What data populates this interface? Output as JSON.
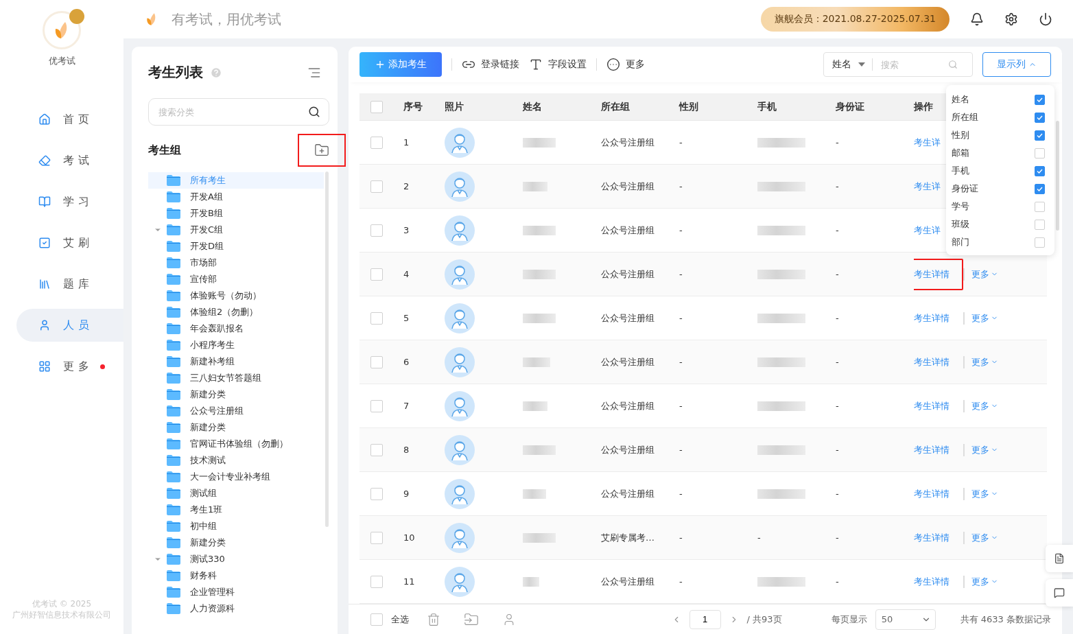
{
  "sidebar": {
    "brand": "优考试",
    "nav": [
      {
        "label": "首页",
        "selected": false
      },
      {
        "label": "考试",
        "selected": false
      },
      {
        "label": "学习",
        "selected": false
      },
      {
        "label": "艾刷",
        "selected": false
      },
      {
        "label": "题库",
        "selected": false
      },
      {
        "label": "人员",
        "selected": true
      },
      {
        "label": "更多",
        "selected": false,
        "badge": true
      }
    ],
    "footer": [
      "优考试 © 2025",
      "广州好智信息技术有限公司"
    ]
  },
  "header": {
    "slogan": "有考试，用优考试",
    "membership": "旗舰会员：2021.08.27-2025.07.31"
  },
  "groups_panel": {
    "title": "考生列表",
    "search": {
      "placeholder": "搜索分类"
    },
    "section": "考生组",
    "add_highlighted": true,
    "tree": [
      {
        "label": "所有考生",
        "selected": true
      },
      {
        "label": "开发A组",
        "selected": false
      },
      {
        "label": "开发B组",
        "selected": false
      },
      {
        "label": "开发C组",
        "selected": false,
        "expanded": true
      },
      {
        "label": "开发D组",
        "selected": false
      },
      {
        "label": "市场部",
        "selected": false
      },
      {
        "label": "宣传部",
        "selected": false
      },
      {
        "label": "体验账号（勿动）",
        "selected": false
      },
      {
        "label": "体验组2（勿删）",
        "selected": false
      },
      {
        "label": "年会轰趴报名",
        "selected": false
      },
      {
        "label": "小程序考生",
        "selected": false
      },
      {
        "label": "新建补考组",
        "selected": false
      },
      {
        "label": "三八妇女节答题组",
        "selected": false
      },
      {
        "label": "新建分类",
        "selected": false
      },
      {
        "label": "公众号注册组",
        "selected": false
      },
      {
        "label": "新建分类",
        "selected": false
      },
      {
        "label": "官网证书体验组（勿删）",
        "selected": false
      },
      {
        "label": "技术测试",
        "selected": false
      },
      {
        "label": "大一会计专业补考组",
        "selected": false
      },
      {
        "label": "测试组",
        "selected": false
      },
      {
        "label": "考生1班",
        "selected": false
      },
      {
        "label": "初中组",
        "selected": false
      },
      {
        "label": "新建分类",
        "selected": false
      },
      {
        "label": "测试330",
        "selected": false,
        "expanded": true
      },
      {
        "label": "财务科",
        "selected": false
      },
      {
        "label": "企业管理科",
        "selected": false
      },
      {
        "label": "人力资源科",
        "selected": false
      }
    ]
  },
  "toolbar": {
    "add": "添加考生",
    "actions": [
      "登录链接",
      "字段设置",
      "更多"
    ],
    "search_field": "姓名",
    "search_placeholder": "搜索",
    "columns_button": "显示列"
  },
  "table": {
    "all_checked": false,
    "columns": [
      "序号",
      "照片",
      "姓名",
      "所在组",
      "性别",
      "手机",
      "身份证",
      "操作"
    ],
    "rows": [
      {
        "index": "1",
        "group": "公众号注册组",
        "gender": "-",
        "id_card": "-",
        "action": "考生详",
        "selected": false,
        "highlighted": false
      },
      {
        "index": "2",
        "group": "公众号注册组",
        "gender": "-",
        "id_card": "-",
        "action": "考生详",
        "selected": false,
        "highlighted": false
      },
      {
        "index": "3",
        "group": "公众号注册组",
        "gender": "-",
        "id_card": "-",
        "action": "考生详",
        "selected": false,
        "highlighted": false
      },
      {
        "index": "4",
        "group": "公众号注册组",
        "gender": "-",
        "id_card": "-",
        "action": "考生详情",
        "more": "更多",
        "selected": false,
        "highlighted": true
      },
      {
        "index": "5",
        "group": "公众号注册组",
        "gender": "-",
        "id_card": "-",
        "action": "考生详情",
        "more": "更多",
        "selected": false,
        "highlighted": false
      },
      {
        "index": "6",
        "group": "公众号注册组",
        "gender": "-",
        "id_card": "-",
        "action": "考生详情",
        "more": "更多",
        "selected": false,
        "highlighted": false
      },
      {
        "index": "7",
        "group": "公众号注册组",
        "gender": "-",
        "id_card": "-",
        "action": "考生详情",
        "more": "更多",
        "selected": false,
        "highlighted": false
      },
      {
        "index": "8",
        "group": "公众号注册组",
        "gender": "-",
        "id_card": "-",
        "action": "考生详情",
        "more": "更多",
        "selected": false,
        "highlighted": false
      },
      {
        "index": "9",
        "group": "公众号注册组",
        "gender": "-",
        "id_card": "-",
        "action": "考生详情",
        "more": "更多",
        "selected": false,
        "highlighted": false
      },
      {
        "index": "10",
        "group": "艾刷专属考…",
        "gender": "-",
        "phone": "-",
        "id_card": "-",
        "action": "考生详情",
        "more": "更多",
        "selected": false,
        "highlighted": false
      },
      {
        "index": "11",
        "group": "公众号注册组",
        "gender": "-",
        "id_card": "-",
        "action": "考生详情",
        "more": "更多",
        "selected": false,
        "highlighted": false
      }
    ]
  },
  "column_menu": [
    {
      "label": "姓名",
      "checked": true
    },
    {
      "label": "所在组",
      "checked": true
    },
    {
      "label": "性别",
      "checked": true
    },
    {
      "label": "邮箱",
      "checked": false
    },
    {
      "label": "手机",
      "checked": true
    },
    {
      "label": "身份证",
      "checked": true
    },
    {
      "label": "学号",
      "checked": false
    },
    {
      "label": "班级",
      "checked": false
    },
    {
      "label": "部门",
      "checked": false
    }
  ],
  "footer": {
    "select_all": {
      "label": "全选",
      "checked": false
    },
    "page": "1",
    "total_pages": "/ 共93页",
    "page_size_label": "每页显示",
    "page_size": "50",
    "total": "共有 4633 条数据记录"
  }
}
